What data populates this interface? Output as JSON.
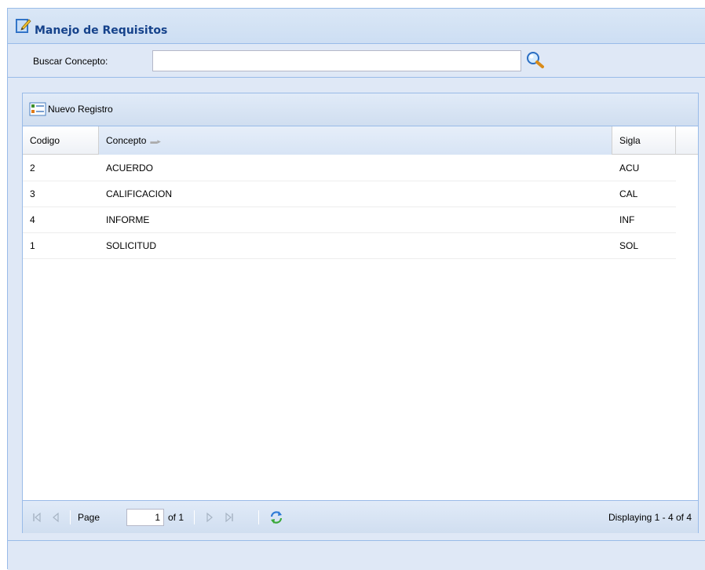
{
  "panel": {
    "title": "Manejo de Requisitos",
    "title_icon": "edit-icon"
  },
  "search": {
    "label": "Buscar Concepto:",
    "value": "",
    "placeholder": "",
    "button_icon": "search-icon"
  },
  "toolbar": {
    "new_label": "Nuevo Registro",
    "new_icon": "form-icon"
  },
  "grid": {
    "columns": [
      "Codigo",
      "Concepto",
      "Sigla"
    ],
    "sorted_column": "Concepto",
    "rows": [
      {
        "codigo": "2",
        "concepto": "ACUERDO",
        "sigla": "ACU"
      },
      {
        "codigo": "3",
        "concepto": "CALIFICACION",
        "sigla": "CAL"
      },
      {
        "codigo": "4",
        "concepto": "INFORME",
        "sigla": "INF"
      },
      {
        "codigo": "1",
        "concepto": "SOLICITUD",
        "sigla": "SOL"
      }
    ]
  },
  "paging": {
    "page_label": "Page",
    "page_value": "1",
    "of_label": "of 1",
    "display": "Displaying 1 - 4 of 4"
  },
  "colors": {
    "accent": "#15428b",
    "border": "#99bbe8",
    "panel_bg": "#dfe8f6"
  }
}
